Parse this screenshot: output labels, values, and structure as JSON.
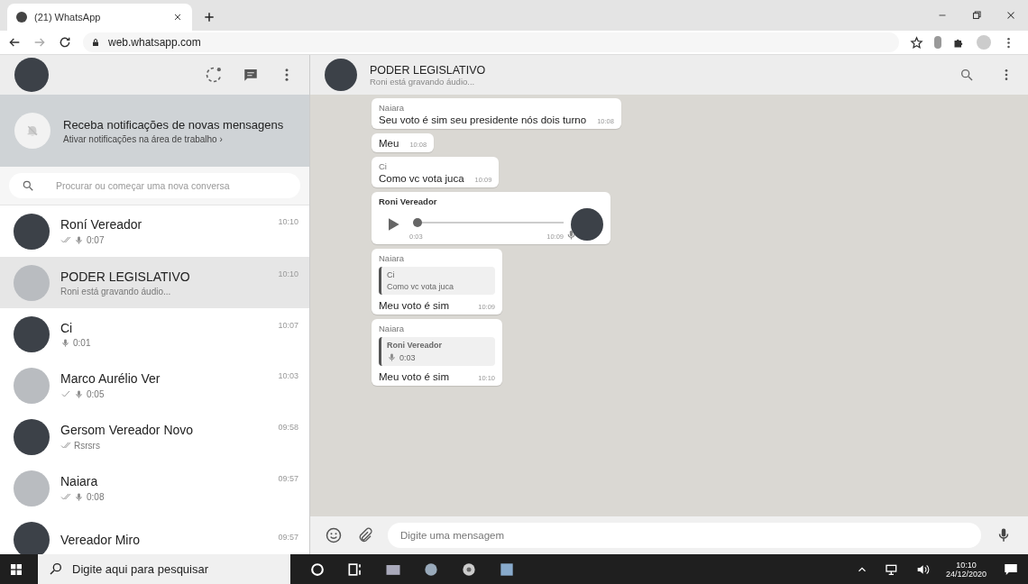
{
  "browser": {
    "tab_title": "(21) WhatsApp",
    "url": "web.whatsapp.com"
  },
  "notification": {
    "title": "Receba notificações de novas mensagens",
    "link": "Ativar notificações na área de trabalho ›"
  },
  "search": {
    "placeholder": "Procurar ou começar uma nova conversa"
  },
  "chats": [
    {
      "name": "Roní Vereador",
      "time": "10:10",
      "double_check": true,
      "single_check": false,
      "mic": true,
      "preview": "0:07",
      "selected": false
    },
    {
      "name": "PODER LEGISLATIVO",
      "time": "10:10",
      "double_check": false,
      "single_check": false,
      "mic": false,
      "preview": "Roni está gravando áudio...",
      "selected": true
    },
    {
      "name": "Ci",
      "time": "10:07",
      "double_check": false,
      "single_check": false,
      "mic": true,
      "preview": "0:01",
      "selected": false
    },
    {
      "name": "Marco Aurélio Ver",
      "time": "10:03",
      "double_check": false,
      "single_check": true,
      "mic": true,
      "preview": "0:05",
      "selected": false
    },
    {
      "name": "Gersom Vereador Novo",
      "time": "09:58",
      "double_check": true,
      "single_check": false,
      "mic": false,
      "preview": "Rsrsrs",
      "selected": false
    },
    {
      "name": "Naiara",
      "time": "09:57",
      "double_check": true,
      "single_check": false,
      "mic": true,
      "preview": "0:08",
      "selected": false
    },
    {
      "name": "Vereador Miro",
      "time": "09:57",
      "selected": false
    }
  ],
  "conversation": {
    "title": "PODER LEGISLATIVO",
    "status": "Roni está gravando áudio..."
  },
  "messages": [
    {
      "kind": "text",
      "sender": "Naiara",
      "text": "Seu voto é sim seu presidente nós dois turno",
      "time": "10:08"
    },
    {
      "kind": "text",
      "text": "Meu",
      "time": "10:08"
    },
    {
      "kind": "text",
      "sender": "Ci",
      "text": "Como vc vota juca",
      "time": "10:09"
    },
    {
      "kind": "voice",
      "sender": "Roni Vereador",
      "duration": "0:03",
      "time": "10:09",
      "level": 0
    },
    {
      "kind": "quote",
      "sender": "Naiara",
      "quote_sender": "Ci",
      "quote_mic": false,
      "quote_text": "Como vc vota juca",
      "text": "Meu voto é sim",
      "time": "10:09"
    },
    {
      "kind": "quote",
      "sender": "Naiara",
      "quote_sender": "Roni Vereador",
      "quote_mic": true,
      "quote_text": "0:03",
      "text": "Meu voto é sim",
      "time": "10:10"
    }
  ],
  "composer": {
    "placeholder": "Digite uma mensagem"
  },
  "taskbar": {
    "search_placeholder": "Digite aqui para pesquisar",
    "time": "10:10",
    "date": "24/12/2020"
  }
}
